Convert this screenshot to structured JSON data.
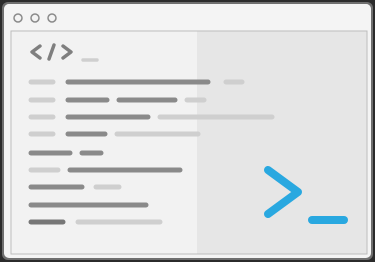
{
  "window": {
    "title_bar_dots": [
      "dot",
      "dot",
      "dot"
    ],
    "colors": {
      "frame": "#6f6f6f",
      "chrome": "#f4f4f4",
      "editor_left": "#f2f2f2",
      "editor_right": "#e6e6e6",
      "code_light": "#cfcfcf",
      "code_dark": "#8a8a8a",
      "code_darker": "#777777",
      "terminal_accent": "#29a8e0"
    }
  },
  "icons": {
    "code_tag": "code-tag-icon",
    "terminal_prompt": "terminal-prompt-icon"
  }
}
